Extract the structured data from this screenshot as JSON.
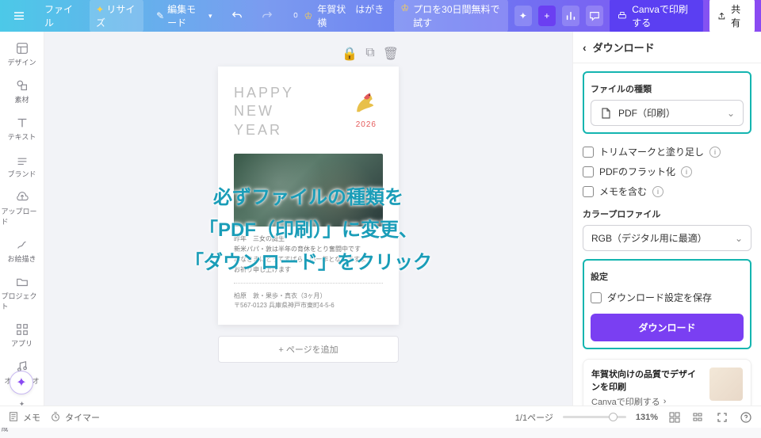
{
  "topbar": {
    "file": "ファイル",
    "resize": "リサイズ",
    "edit_mode": "編集モード",
    "doc_name": "年賀状　はがき　横",
    "trial": "プロを30日間無料で試す",
    "print": "Canvaで印刷する",
    "share": "共有"
  },
  "sidebar": {
    "items": [
      {
        "label": "デザイン"
      },
      {
        "label": "素材"
      },
      {
        "label": "テキスト"
      },
      {
        "label": "ブランド"
      },
      {
        "label": "アップロード"
      },
      {
        "label": "お絵描き"
      },
      {
        "label": "プロジェクト"
      },
      {
        "label": "アプリ"
      },
      {
        "label": "オーディオ"
      },
      {
        "label": "マジック生成"
      }
    ]
  },
  "postcard": {
    "title_l1": "HAPPY",
    "title_l2": "NEW",
    "title_l3": "YEAR",
    "year": "2026",
    "body_l1": "昨年　三女の誕生",
    "body_l2": "新米パパ・敦は半年の育休をとり奮闘中です",
    "body_l3": "みなさまにとってすばらしい一年となりますよう",
    "body_l4": "お祈り申し上げます",
    "sign_l1": "柏原　敦・果歩・真衣（3ヶ月）",
    "sign_l2": "〒567-0123 兵庫県神戸市東町4-5-6"
  },
  "addpage": "+ ページを追加",
  "panel": {
    "title": "ダウンロード",
    "section_filetype": "ファイルの種類",
    "filetype_value": "PDF（印刷）",
    "opt_trim": "トリムマークと塗り足し",
    "opt_flatten": "PDFのフラット化",
    "opt_notes": "メモを含む",
    "section_color": "カラープロファイル",
    "color_value": "RGB（デジタル用に最適）",
    "section_settings": "設定",
    "opt_save": "ダウンロード設定を保存",
    "download_btn": "ダウンロード",
    "promo_title": "年賀状向けの品質でデザインを印刷",
    "promo_link": "Canvaで印刷する"
  },
  "bottombar": {
    "memo": "メモ",
    "timer": "タイマー",
    "pages": "1/1ページ",
    "zoom": "131%"
  },
  "overlay": {
    "l1": "必ずファイルの種類を",
    "l2": "「PDF（印刷）」に変更、",
    "l3": "「ダウンロード」をクリック"
  }
}
